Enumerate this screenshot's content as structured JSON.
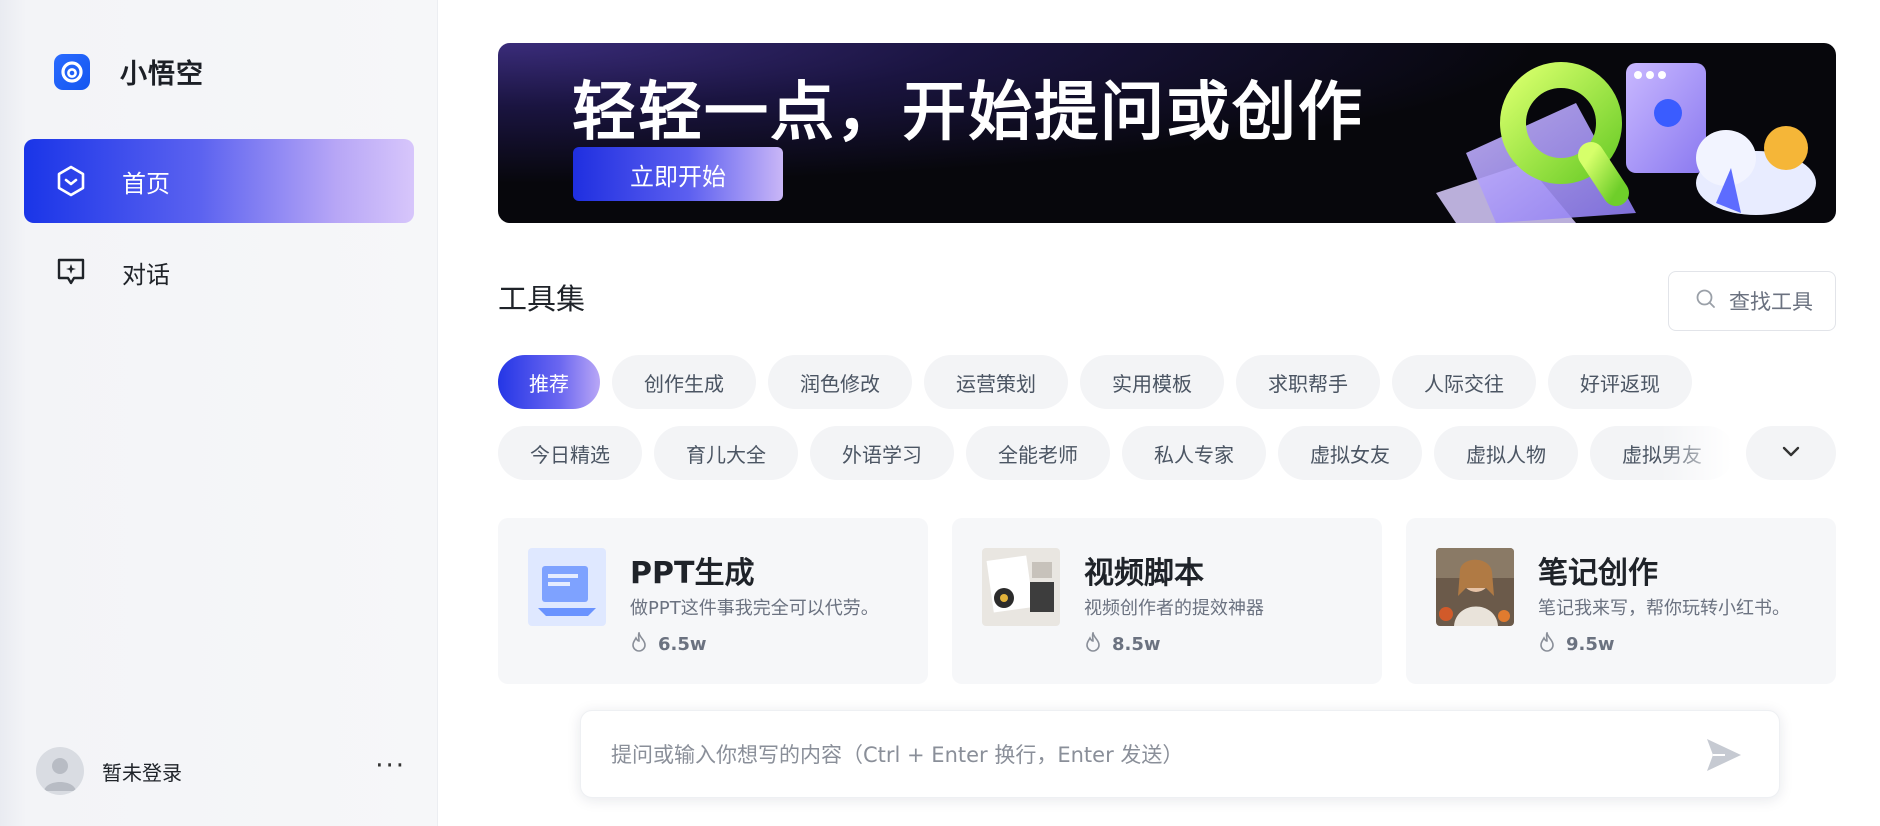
{
  "sidebar": {
    "brand": {
      "name": "小悟空",
      "icon": "brand-logo-icon"
    },
    "nav": [
      {
        "label": "首页",
        "icon": "home-hexagon-icon",
        "active": true
      },
      {
        "label": "对话",
        "icon": "chat-sparkle-icon",
        "active": false
      }
    ],
    "user": {
      "name": "暂未登录",
      "more": "···"
    }
  },
  "banner": {
    "title": "轻轻一点，开始提问或创作",
    "cta": "立即开始"
  },
  "tools": {
    "title": "工具集",
    "search_placeholder": "查找工具",
    "chips_row1": [
      "推荐",
      "创作生成",
      "润色修改",
      "运营策划",
      "实用模板",
      "求职帮手",
      "人际交往",
      "好评返现"
    ],
    "chips_row2": [
      "今日精选",
      "育儿大全",
      "外语学习",
      "全能老师",
      "私人专家",
      "虚拟女友",
      "虚拟人物",
      "虚拟男友"
    ],
    "active_chip": "推荐",
    "cards": [
      {
        "title": "PPT生成",
        "desc": "做PPT这件事我完全可以代劳。",
        "stat": "6.5w"
      },
      {
        "title": "视频脚本",
        "desc": "视频创作者的提效神器",
        "stat": "8.5w"
      },
      {
        "title": "笔记创作",
        "desc": "笔记我来写，帮你玩转小红书。",
        "stat": "9.5w"
      }
    ]
  },
  "prompt": {
    "placeholder": "提问或输入你想写的内容（Ctrl + Enter 换行，Enter 发送）"
  },
  "colors": {
    "accent": "#1a35e8",
    "accent_light": "#c9b6f7",
    "sidebar_bg": "#f6f7f9",
    "chip_bg": "#f3f4f6"
  }
}
